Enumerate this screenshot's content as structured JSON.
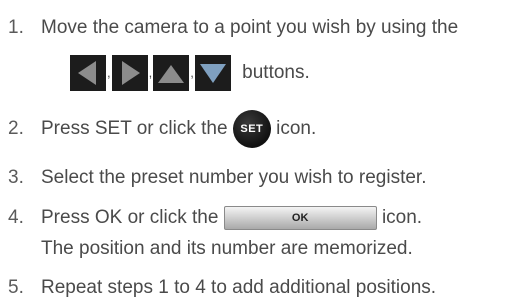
{
  "steps": [
    {
      "number": "1.",
      "line1": "Move the camera to a point you wish by using the",
      "separator": ",",
      "line2_suffix": "buttons."
    },
    {
      "number": "2.",
      "prefix": "Press SET or click the",
      "icon_label": "SET",
      "suffix": "icon."
    },
    {
      "number": "3.",
      "text": "Select the preset number you wish to register."
    },
    {
      "number": "4.",
      "prefix": "Press OK or click the",
      "icon_label": "OK",
      "suffix": "icon.",
      "line2": "The position and its number are memorized."
    },
    {
      "number": "5.",
      "text": "Repeat steps 1 to 4 to add additional positions."
    }
  ],
  "icons": {
    "left": "left-arrow-icon",
    "right": "right-arrow-icon",
    "up": "up-arrow-icon",
    "down": "down-arrow-icon",
    "set": "set-icon",
    "ok": "ok-icon"
  },
  "colors": {
    "text": "#4a4a4a",
    "button_bg": "#1c1c1c",
    "arrow_gray": "#8c8c8c",
    "arrow_blue": "#7fa0c0"
  }
}
